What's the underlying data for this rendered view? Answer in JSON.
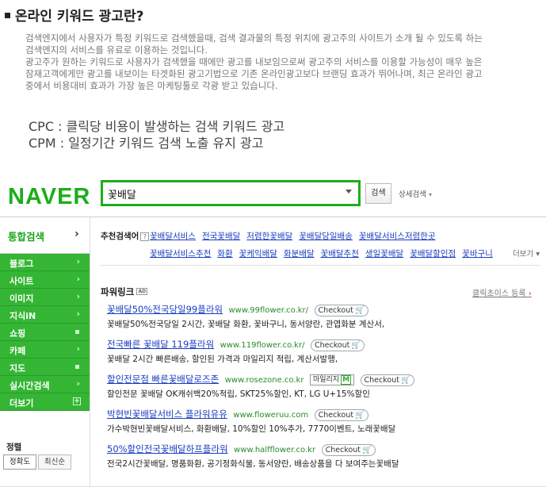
{
  "intro": {
    "title": "온라인 키워드 광고란?",
    "paragraph1_line1": "검색엔지에서 사용자가 특정 키워드로 검색했을때, 검색 결과물의 특정 위치에 광고주의 사이트가 소개 될 수 있도록 하는",
    "paragraph1_line2": "검색엔지의 서비스를 유료로 이용하는 것입니다.",
    "paragraph2_line1": "광고주가 원하는 키워드로 사용자가 검색했을 때에만 광고를 내보임으로써 광고주의 서비스를 이용할 가능성이 매우 높은",
    "paragraph2_line2": "잠재고객에게만 광고를 내보이는 타겟화된 광고기법으로 기존 온라인광고보다 브랜딩 효과가 뛰어나며, 최근 온라인 광고",
    "paragraph2_line3": "중에서 비용대비 효과가 가장 높은 마케팅툴로 각광 받고 있습니다.",
    "cpc": "CPC : 클릭당 비용이 발생하는 검색 키워드 광고",
    "cpm": "CPM : 일정기간 키워드 검색 노출 유지 광고"
  },
  "naver": {
    "logo": "NAVER",
    "search_value": "꽃배달",
    "search_button": "검색",
    "advanced_search": "상세검색",
    "sidebar": {
      "top_label": "통합검색",
      "top_arrow": "›",
      "items": [
        {
          "label": "블로그",
          "mark": "›"
        },
        {
          "label": "사이트",
          "mark": "›"
        },
        {
          "label": "이미지",
          "mark": "›"
        },
        {
          "label": "지식iN",
          "mark": "›"
        },
        {
          "label": "쇼핑",
          "mark": "■"
        },
        {
          "label": "카페",
          "mark": "›"
        },
        {
          "label": "지도",
          "mark": "■"
        },
        {
          "label": "실시간검색",
          "mark": "›"
        },
        {
          "label": "더보기",
          "mark": "+"
        }
      ],
      "sort_label": "정렬",
      "sort_options": [
        "정확도",
        "최신순"
      ]
    },
    "related": {
      "label": "추천검색어",
      "help": "?",
      "row1": [
        "꽃배달서비스",
        "전국꽃배달",
        "저렴한꽃배달",
        "꽃배달당일배송",
        "꽃배달서비스저렴한곳"
      ],
      "row2": [
        "꽃배달서비스추천",
        "화환",
        "꽃케익배달",
        "화분배달",
        "꽃배달추천",
        "생일꽃배달",
        "꽃배달할인점",
        "꽃바구니"
      ],
      "more": "더보기"
    },
    "powerlink": {
      "title": "파워링크",
      "ad_badge": "AD",
      "click_choice": "클릭초이스 등록",
      "ads": [
        {
          "title": "꽃배달50%전국당일99플라워",
          "url": "www.99flower.co.kr/",
          "badges": [
            "Checkout"
          ],
          "desc": "꽃배달50%전국당일 2시간, 꽃배달 화환, 꽃바구니, 동서양란, 관엽화분 계산서,"
        },
        {
          "title": "전국빠른 꽃배달 119플라워",
          "url": "www.119flower.co.kr/",
          "badges": [
            "Checkout"
          ],
          "desc": "꽃배달 2시간 빠른배송, 할인된 가격과 마일리지 적립, 계산서발행,"
        },
        {
          "title": "할인전문점 빠른꽃배달로즈존",
          "url": "www.rosezone.co.kr",
          "badges": [
            "마일리지",
            "Checkout"
          ],
          "desc": "할인전문 꽃배달 OK캐쉬백20%적립, SKT25%할인, KT, LG U+15%할인"
        },
        {
          "title": "박현빈꽃배달서비스 플라워유유",
          "url": "www.floweruu.com",
          "badges": [
            "Checkout"
          ],
          "desc": "가수박현빈꽃배달서비스, 화환배달, 10%할인 10%추가, 7770이벤트, 노래꽃배달"
        },
        {
          "title": "50%할인전국꽃배달하프플라워",
          "url": "www.halfflower.co.kr",
          "badges": [
            "Checkout"
          ],
          "desc": "전국2시간꽃배달, 명품화환, 공기정화식물, 동서양란, 배송상품을 다 보여주는꽃배달"
        }
      ]
    }
  },
  "colors": {
    "naver_green": "#1aaf1a",
    "sidebar_green": "#34b634",
    "link_blue": "#1a3dc1",
    "url_green": "#2a8a2a"
  }
}
